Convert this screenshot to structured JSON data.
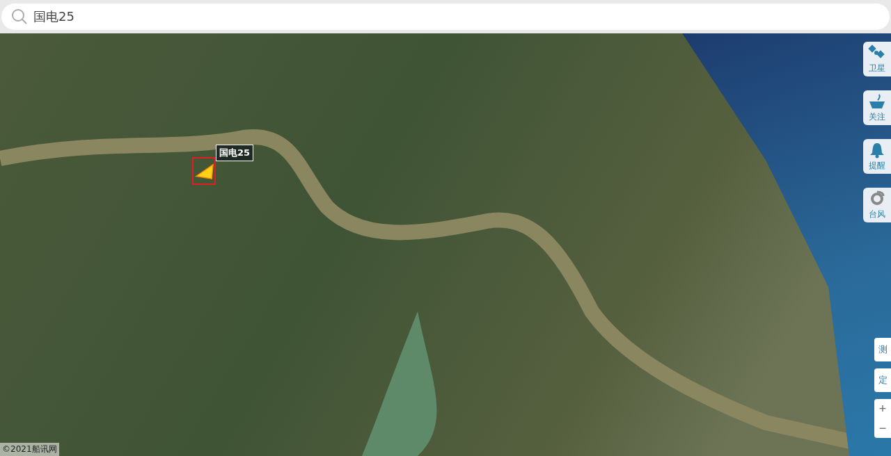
{
  "search": {
    "value": "国电25"
  },
  "ship": {
    "label": "国电25"
  },
  "side_buttons": [
    {
      "kind": "satellite",
      "label": "卫星"
    },
    {
      "kind": "ship",
      "label": "关注"
    },
    {
      "kind": "bell",
      "label": "提醒"
    },
    {
      "kind": "typhoon",
      "label": "台风"
    }
  ],
  "tool_buttons": [
    {
      "label": "测"
    },
    {
      "label": "定"
    }
  ],
  "zoom": {
    "in": "+",
    "out": "−"
  },
  "copyright": "©2021船讯网"
}
